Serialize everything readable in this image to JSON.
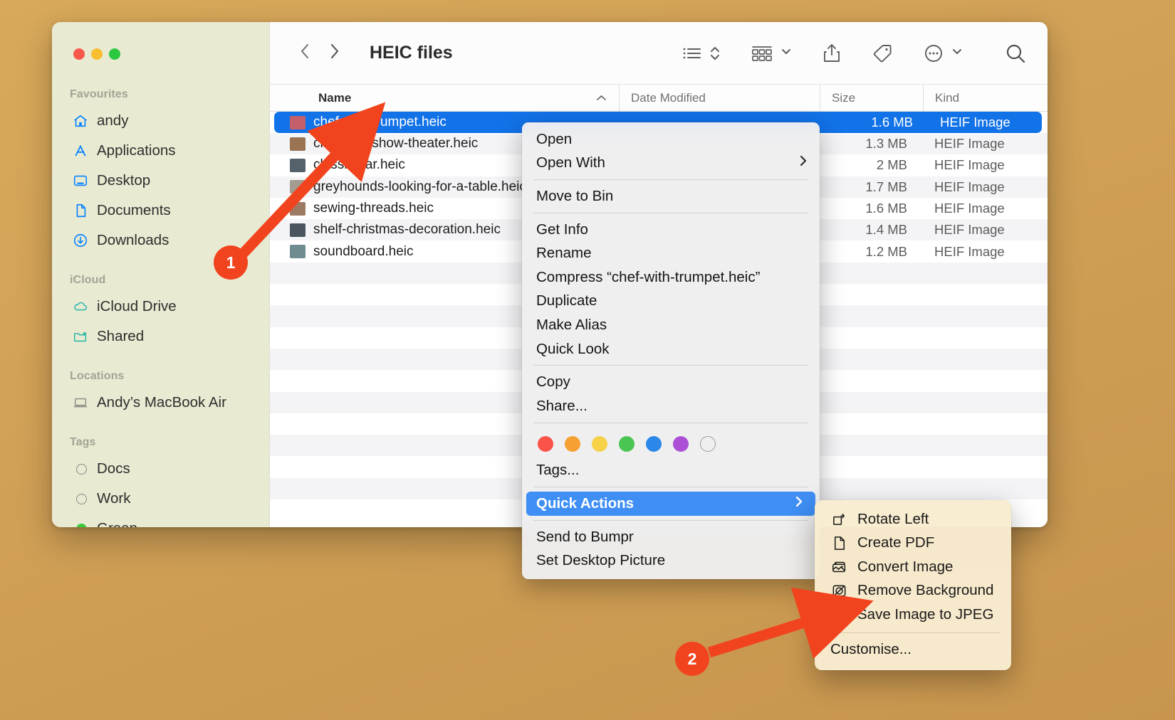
{
  "window": {
    "title": "HEIC files",
    "traffic_lights": [
      "close",
      "minimise",
      "zoom"
    ],
    "nav_back": "‹",
    "nav_forward": "›"
  },
  "toolbar": {
    "view_list_icon": "list-view-icon",
    "view_sort_icon": "sort-chevrons-icon",
    "group_icon": "group-by-icon",
    "group_chevron": "chevron-down-icon",
    "share_icon": "share-icon",
    "tag_icon": "tag-icon",
    "more_icon": "more-ellipsis-icon",
    "more_chevron": "chevron-down-icon",
    "search_icon": "search-icon"
  },
  "columns": {
    "name": "Name",
    "sort_arrow": "^",
    "date_modified": "Date Modified",
    "size": "Size",
    "kind": "Kind"
  },
  "files": [
    {
      "name": "chef-with-trumpet.heic",
      "size": "1.6 MB",
      "kind": "HEIF Image",
      "selected": true,
      "thumb": "#c3606a"
    },
    {
      "name": "childrens-show-theater.heic",
      "size": "1.3 MB",
      "kind": "HEIF Image",
      "selected": false,
      "thumb": "#9a7352"
    },
    {
      "name": "classic-car.heic",
      "size": "2 MB",
      "kind": "HEIF Image",
      "selected": false,
      "thumb": "#55626c"
    },
    {
      "name": "greyhounds-looking-for-a-table.heic",
      "size": "1.7 MB",
      "kind": "HEIF Image",
      "selected": false,
      "thumb": "#a49c90"
    },
    {
      "name": "sewing-threads.heic",
      "size": "1.6 MB",
      "kind": "HEIF Image",
      "selected": false,
      "thumb": "#9d7a63"
    },
    {
      "name": "shelf-christmas-decoration.heic",
      "size": "1.4 MB",
      "kind": "HEIF Image",
      "selected": false,
      "thumb": "#4a5560"
    },
    {
      "name": "soundboard.heic",
      "size": "1.2 MB",
      "kind": "HEIF Image",
      "selected": false,
      "thumb": "#6f8d91"
    }
  ],
  "sidebar": {
    "sections": [
      {
        "title": "Favourites",
        "items": [
          {
            "label": "andy",
            "icon": "home-icon"
          },
          {
            "label": "Applications",
            "icon": "applications-icon"
          },
          {
            "label": "Desktop",
            "icon": "desktop-icon"
          },
          {
            "label": "Documents",
            "icon": "document-icon"
          },
          {
            "label": "Downloads",
            "icon": "downloads-icon"
          }
        ]
      },
      {
        "title": "iCloud",
        "items": [
          {
            "label": "iCloud Drive",
            "icon": "cloud-icon"
          },
          {
            "label": "Shared",
            "icon": "shared-folder-icon"
          }
        ]
      },
      {
        "title": "Locations",
        "items": [
          {
            "label": "Andy’s MacBook Air",
            "icon": "laptop-icon"
          }
        ]
      },
      {
        "title": "Tags",
        "items": [
          {
            "label": "Docs",
            "icon": "tag-dot-icon",
            "color": ""
          },
          {
            "label": "Work",
            "icon": "tag-dot-icon",
            "color": ""
          },
          {
            "label": "Green",
            "icon": "tag-dot-icon",
            "color": "#3dc93d"
          }
        ]
      }
    ]
  },
  "context_menu": {
    "groups": [
      [
        {
          "label": "Open"
        },
        {
          "label": "Open With",
          "submenu_arrow": "›"
        }
      ],
      [
        {
          "label": "Move to Bin"
        }
      ],
      [
        {
          "label": "Get Info"
        },
        {
          "label": "Rename"
        },
        {
          "label": "Compress “chef-with-trumpet.heic”"
        },
        {
          "label": "Duplicate"
        },
        {
          "label": "Make Alias"
        },
        {
          "label": "Quick Look"
        }
      ],
      [
        {
          "label": "Copy"
        },
        {
          "label": "Share..."
        }
      ]
    ],
    "tag_colors": [
      "#f9534a",
      "#f6a033",
      "#f7d148",
      "#4ac553",
      "#2b87e8",
      "#ac51d6",
      ""
    ],
    "tags_label": "Tags...",
    "quick_actions": {
      "label": "Quick Actions",
      "submenu_arrow": "›",
      "highlighted": true
    },
    "after_items": [
      {
        "label": "Send to Bumpr"
      },
      {
        "label": "Set Desktop Picture"
      }
    ]
  },
  "submenu": {
    "items": [
      {
        "label": "Rotate Left",
        "icon": "rotate-left-icon"
      },
      {
        "label": "Create PDF",
        "icon": "pdf-document-icon"
      },
      {
        "label": "Convert Image",
        "icon": "convert-image-icon"
      },
      {
        "label": "Remove Background",
        "icon": "remove-background-icon"
      },
      {
        "label": "Save Image to JPEG",
        "icon": "ellipsis-circle-icon"
      }
    ],
    "customise": "Customise..."
  },
  "callouts": [
    {
      "number": "1",
      "color": "#f1441e"
    },
    {
      "number": "2",
      "color": "#f1441e"
    }
  ]
}
